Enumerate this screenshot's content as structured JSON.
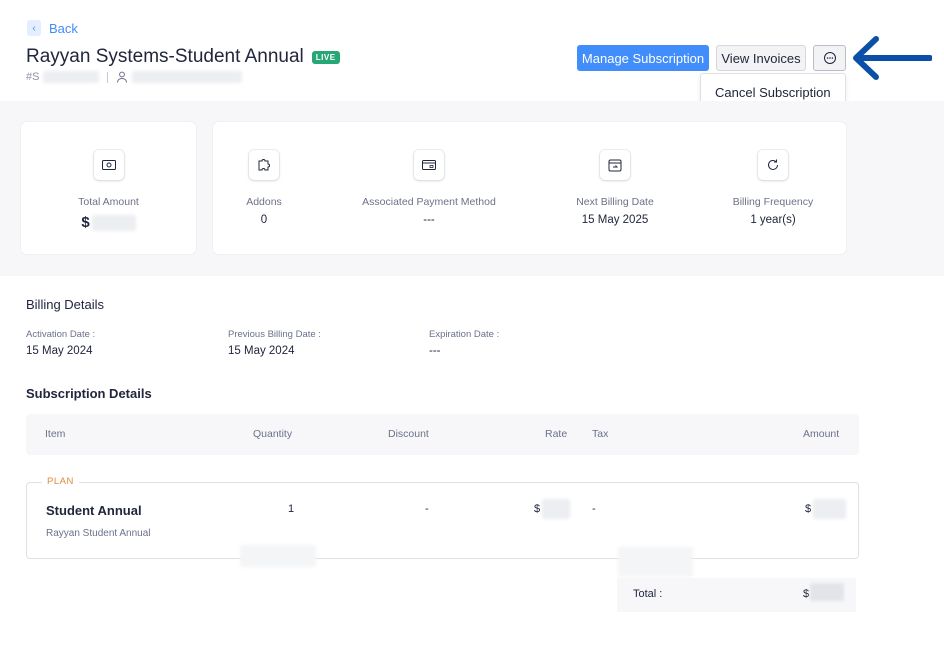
{
  "header": {
    "back_label": "Back",
    "title": "Rayyan Systems-Student Annual",
    "status_badge": "LIVE",
    "sub_prefix": "#S",
    "manage_button": "Manage Subscription",
    "invoices_button": "View Invoices",
    "more_menu": [
      "Cancel Subscription"
    ]
  },
  "overview": {
    "total_amount_label": "Total Amount",
    "total_amount_value": "$",
    "metrics": [
      {
        "label": "Addons",
        "value": "0",
        "icon": "puzzle-icon"
      },
      {
        "label": "Associated Payment Method",
        "value": "---",
        "icon": "card-icon"
      },
      {
        "label": "Next Billing Date",
        "value": "15 May 2025",
        "icon": "calendar-icon"
      },
      {
        "label": "Billing Frequency",
        "value": "1 year(s)",
        "icon": "refresh-icon"
      }
    ]
  },
  "billing": {
    "title": "Billing Details",
    "fields": [
      {
        "label": "Activation Date :",
        "value": "15 May 2024"
      },
      {
        "label": "Previous Billing Date :",
        "value": "15 May 2024"
      },
      {
        "label": "Expiration Date :",
        "value": "---"
      }
    ]
  },
  "subscription": {
    "title": "Subscription Details",
    "columns": [
      "Item",
      "Quantity",
      "Discount",
      "Rate",
      "Tax",
      "Amount"
    ],
    "plan_tag": "PLAN",
    "plan_row": {
      "name": "Student Annual",
      "description": "Rayyan Student Annual",
      "quantity": "1",
      "discount": "-",
      "rate": "$",
      "tax": "-",
      "amount": "$"
    },
    "total_label": "Total :",
    "total_value": "$"
  },
  "colors": {
    "accent": "#408dfb",
    "live": "#27a776",
    "plan_tag": "#e08a38",
    "annotation_arrow": "#0b4fa8"
  }
}
